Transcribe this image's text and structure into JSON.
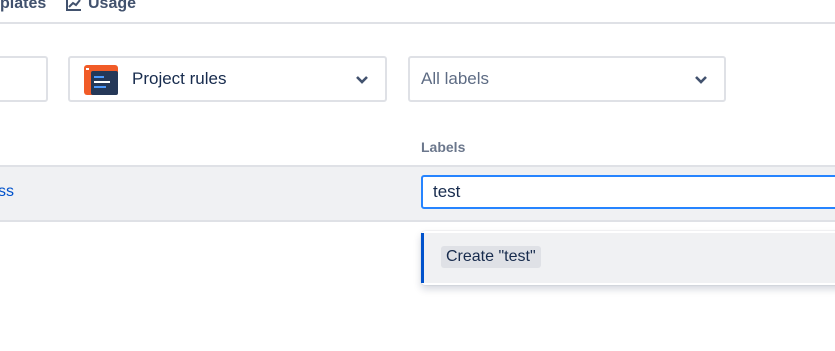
{
  "tabs": {
    "templates_partial": "plates",
    "usage": "Usage"
  },
  "filters": {
    "rules_select": {
      "value": "Project rules"
    },
    "labels_select": {
      "placeholder": "All labels"
    }
  },
  "table": {
    "columns": {
      "labels": "Labels"
    },
    "row": {
      "link_partial": "ss",
      "labels_input_value": "test"
    }
  },
  "dropdown": {
    "create_option": "Create \"test\""
  },
  "colors": {
    "accent": "#0052cc",
    "focus_border": "#2684ff",
    "rules_icon_bg": "#f15b27",
    "rules_icon_dark": "#253858"
  },
  "icons": {
    "usage": "chart-line-icon",
    "rules": "project-rules-icon",
    "chevron": "chevron-down-icon"
  }
}
